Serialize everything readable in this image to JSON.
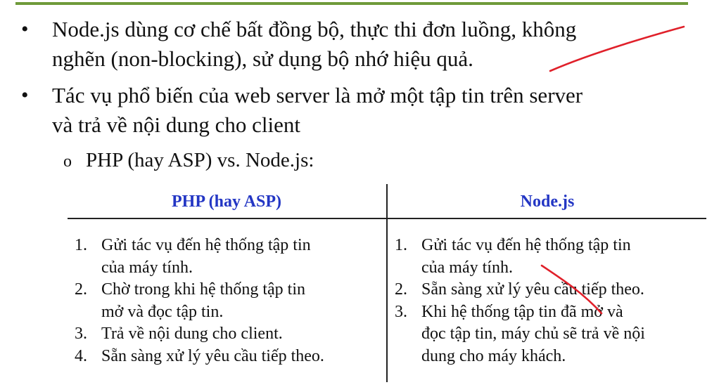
{
  "bullets": [
    {
      "marker": "•",
      "lines": [
        "Node.js dùng cơ chế bất đồng bộ, thực thi đơn luồng, không",
        "nghẽn (non-blocking), sử dụng bộ nhớ hiệu quả."
      ]
    },
    {
      "marker": "•",
      "lines": [
        "Tác vụ phổ biến của web server là mở một tập tin trên server",
        "và trả về nội dung cho client"
      ]
    }
  ],
  "sub_bullet": {
    "marker": "o",
    "text": "PHP (hay ASP) vs. Node.js:"
  },
  "table": {
    "headers": [
      "PHP (hay ASP)",
      "Node.js"
    ],
    "left": [
      {
        "num": "1.",
        "lines": [
          "Gửi tác vụ đến hệ thống tập tin",
          "của máy tính."
        ]
      },
      {
        "num": "2.",
        "lines": [
          "Chờ trong khi hệ thống tập tin",
          "mở và đọc tập tin."
        ]
      },
      {
        "num": "3.",
        "lines": [
          "Trả về nội dung cho client."
        ]
      },
      {
        "num": "4.",
        "lines": [
          "Sẵn sàng xử lý yêu cầu tiếp theo."
        ]
      }
    ],
    "right": [
      {
        "num": "1.",
        "lines": [
          "Gửi tác vụ đến hệ thống tập tin",
          "của máy tính."
        ]
      },
      {
        "num": "2.",
        "lines": [
          "Sẵn sàng xử lý yêu cầu tiếp theo."
        ]
      },
      {
        "num": "3.",
        "lines": [
          "Khi hệ thống tập tin đã mở và",
          "đọc tập tin, máy chủ sẽ trả về nội",
          "dung cho máy khách."
        ]
      }
    ]
  },
  "colors": {
    "accent_rule": "#6f9a3a",
    "header_text": "#2336c4",
    "annotation_ink": "#e0202a"
  }
}
